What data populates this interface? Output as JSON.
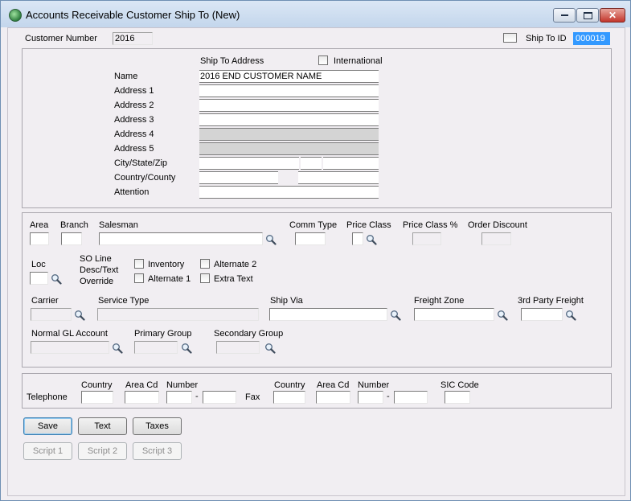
{
  "window": {
    "title": "Accounts Receivable Customer Ship To (New)"
  },
  "header": {
    "customer_number_label": "Customer Number",
    "customer_number_value": "2016",
    "ship_to_id_label": "Ship To ID",
    "ship_to_id_value": "000019"
  },
  "address": {
    "heading": "Ship To Address",
    "international_label": "International",
    "name_label": "Name",
    "name_value": "2016 END CUSTOMER NAME",
    "address1_label": "Address 1",
    "address2_label": "Address 2",
    "address3_label": "Address 3",
    "address4_label": "Address 4",
    "address5_label": "Address 5",
    "city_state_zip_label": "City/State/Zip",
    "country_county_label": "Country/County",
    "attention_label": "Attention"
  },
  "details": {
    "area_label": "Area",
    "branch_label": "Branch",
    "salesman_label": "Salesman",
    "comm_type_label": "Comm Type",
    "price_class_label": "Price Class",
    "price_class_pct_label": "Price Class %",
    "order_discount_label": "Order Discount",
    "loc_label": "Loc",
    "so_line_label_1": "SO Line",
    "so_line_label_2": "Desc/Text",
    "so_line_label_3": "Override",
    "inventory_label": "Inventory",
    "alternate1_label": "Alternate 1",
    "alternate2_label": "Alternate 2",
    "extra_text_label": "Extra Text",
    "carrier_label": "Carrier",
    "service_type_label": "Service Type",
    "ship_via_label": "Ship Via",
    "freight_zone_label": "Freight Zone",
    "third_party_freight_label": "3rd Party Freight",
    "normal_gl_label": "Normal GL Account",
    "primary_group_label": "Primary Group",
    "secondary_group_label": "Secondary Group"
  },
  "phone": {
    "telephone_label": "Telephone",
    "fax_label": "Fax",
    "country_label": "Country",
    "area_cd_label": "Area Cd",
    "number_label": "Number",
    "dash": "-",
    "sic_code_label": "SIC Code"
  },
  "buttons": {
    "save": "Save",
    "text": "Text",
    "taxes": "Taxes",
    "script1": "Script 1",
    "script2": "Script 2",
    "script3": "Script 3"
  }
}
